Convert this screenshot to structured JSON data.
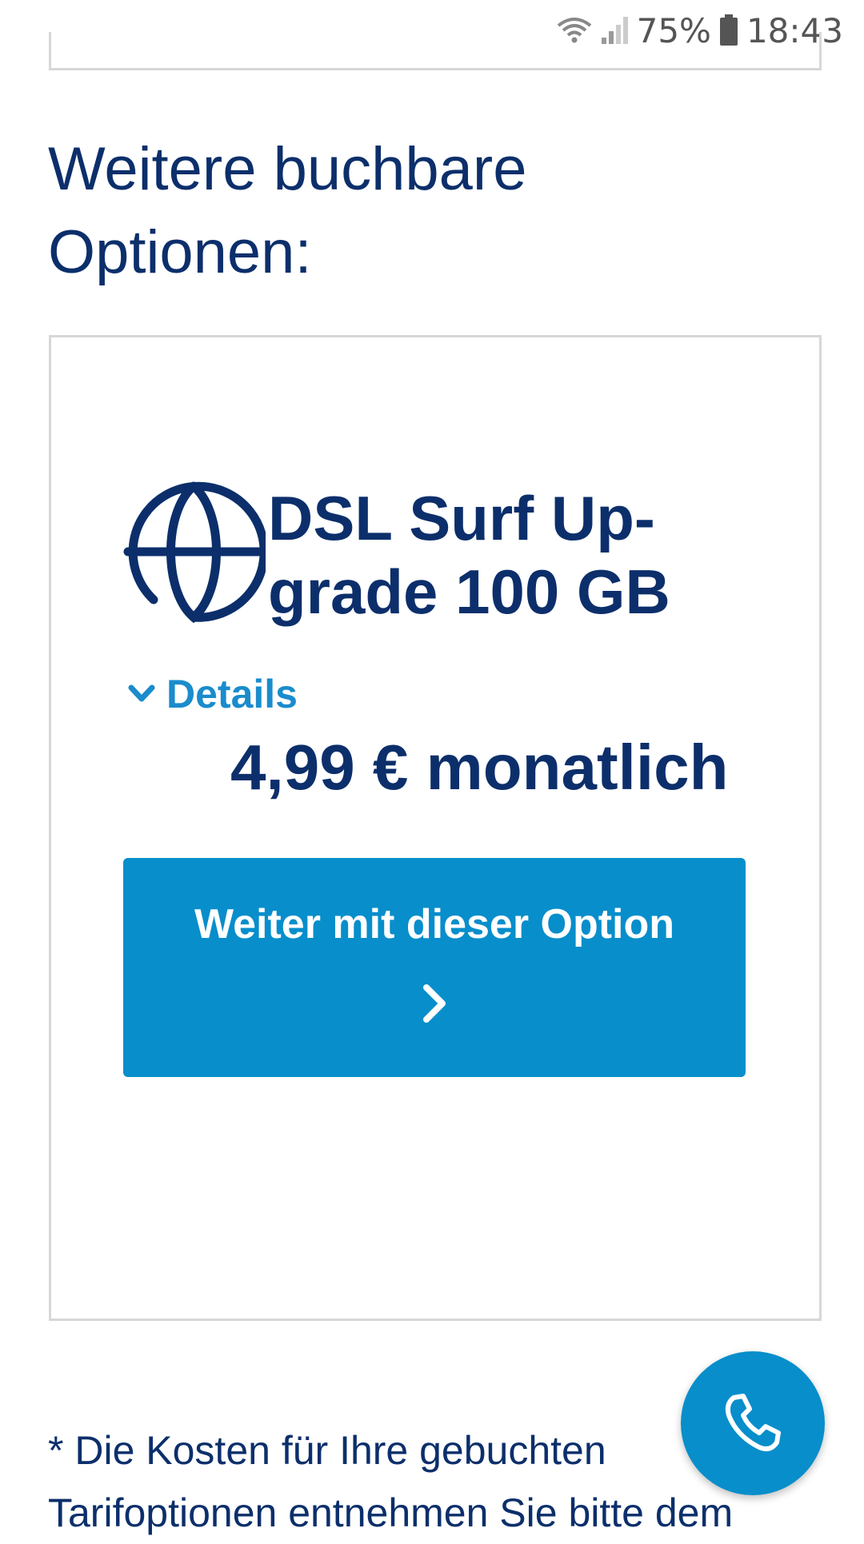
{
  "status_bar": {
    "battery_percent": "75%",
    "time": "18:43",
    "icons": [
      "wifi-icon",
      "signal-icon",
      "battery-icon"
    ]
  },
  "section": {
    "title_line1": "Weitere buchbare",
    "title_line2": "Optionen:"
  },
  "option": {
    "icon": "globe-icon",
    "title_line1": "DSL Surf Up-",
    "title_line2": "grade 100 GB",
    "details_label": "Details",
    "price": "4,99 € monatlich",
    "cta_label": "Weiter mit dieser Option"
  },
  "footnote": {
    "line1": "* Die Kosten für Ihre gebuchten",
    "line2": "Tarifoptionen entnehmen Sie bitte dem"
  },
  "fab": {
    "icon": "phone-icon"
  },
  "colors": {
    "navy": "#0c2f6b",
    "accent_blue": "#078ecb",
    "link_blue": "#1a8ccc",
    "border_gray": "#d7d7d7"
  }
}
